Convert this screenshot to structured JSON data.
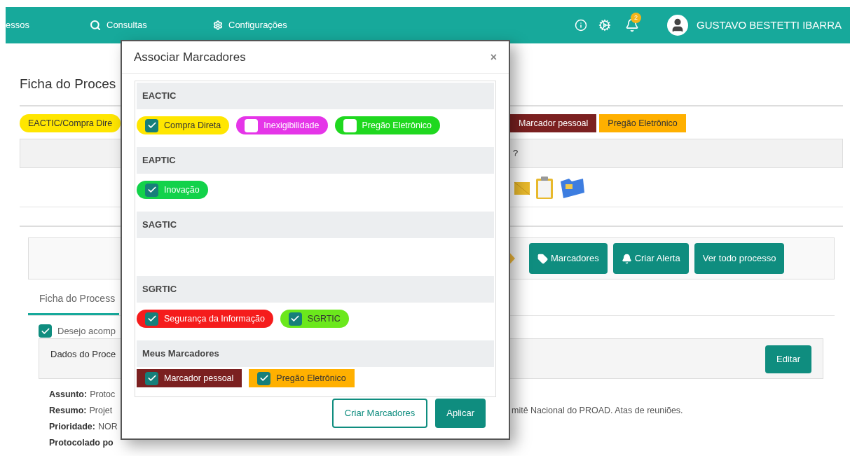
{
  "topbar": {
    "nav": [
      {
        "label": "essos"
      },
      {
        "label": "Consultas"
      },
      {
        "label": "Configurações"
      }
    ],
    "notification_count": "2",
    "user": "GUSTAVO BESTETTI IBARRA"
  },
  "page": {
    "title": "Ficha do Proces",
    "tags_left": [
      {
        "label": "EACTIC/Compra Dire",
        "color": "#ffe600",
        "kind": "pill"
      }
    ],
    "tags_right": [
      {
        "label": "Marcador pessoal",
        "color": "#7b2020",
        "kind": "flag"
      },
      {
        "label": "Pregão Eletrônico",
        "color": "#ffb000",
        "kind": "flag"
      }
    ],
    "question": "?",
    "actions": [
      "Marcadores",
      "Criar Alerta",
      "Ver todo processo"
    ],
    "tab": "Ficha do Process",
    "follow": {
      "label": "Desejo acomp",
      "checked": true
    },
    "panel_title": "Dados do Proce",
    "edit": "Editar",
    "fields": [
      {
        "label": "Assunto:",
        "value": "Protoc"
      },
      {
        "label": "Resumo:",
        "value": "Projet"
      },
      {
        "label": "Prioridade:",
        "value": "NOR"
      },
      {
        "label": "Protocolado po"
      }
    ],
    "resumo_tail": "mitê Nacional do PROAD. Atas de reuniões."
  },
  "modal": {
    "title": "Associar Marcadores",
    "close": "×",
    "groups": [
      {
        "name": "EACTIC",
        "tags": [
          {
            "label": "Compra Direta",
            "color": "#ffe600",
            "kind": "pill",
            "checked": true
          },
          {
            "label": "Inexigibilidade",
            "color": "#e535e8",
            "kind": "pill",
            "checked": false
          },
          {
            "label": "Pregão Eletrônico",
            "color": "#1fd81f",
            "kind": "pill",
            "checked": false
          }
        ]
      },
      {
        "name": "EAPTIC",
        "tags": [
          {
            "label": "Inovação",
            "color": "#12d24a",
            "kind": "pill",
            "checked": true
          }
        ]
      },
      {
        "name": "SAGTIC"
      },
      {
        "name": "SGRTIC",
        "tags": [
          {
            "label": "Segurança da Informação",
            "color": "#f51c1c",
            "kind": "pill",
            "checked": true
          },
          {
            "label": "SGRTIC",
            "color": "#6be81c",
            "kind": "pill",
            "checked": true
          }
        ]
      },
      {
        "name": "Meus Marcadores",
        "tags": [
          {
            "label": "Marcador pessoal",
            "color": "#7b2020",
            "kind": "flag",
            "checked": true
          },
          {
            "label": "Pregão Eletrônico",
            "color": "#ffb000",
            "kind": "flag",
            "checked": true
          }
        ]
      }
    ],
    "buttons": [
      {
        "label": "Criar Marcadores",
        "kind": "outline"
      },
      {
        "label": "Aplicar",
        "kind": "solid"
      }
    ]
  }
}
